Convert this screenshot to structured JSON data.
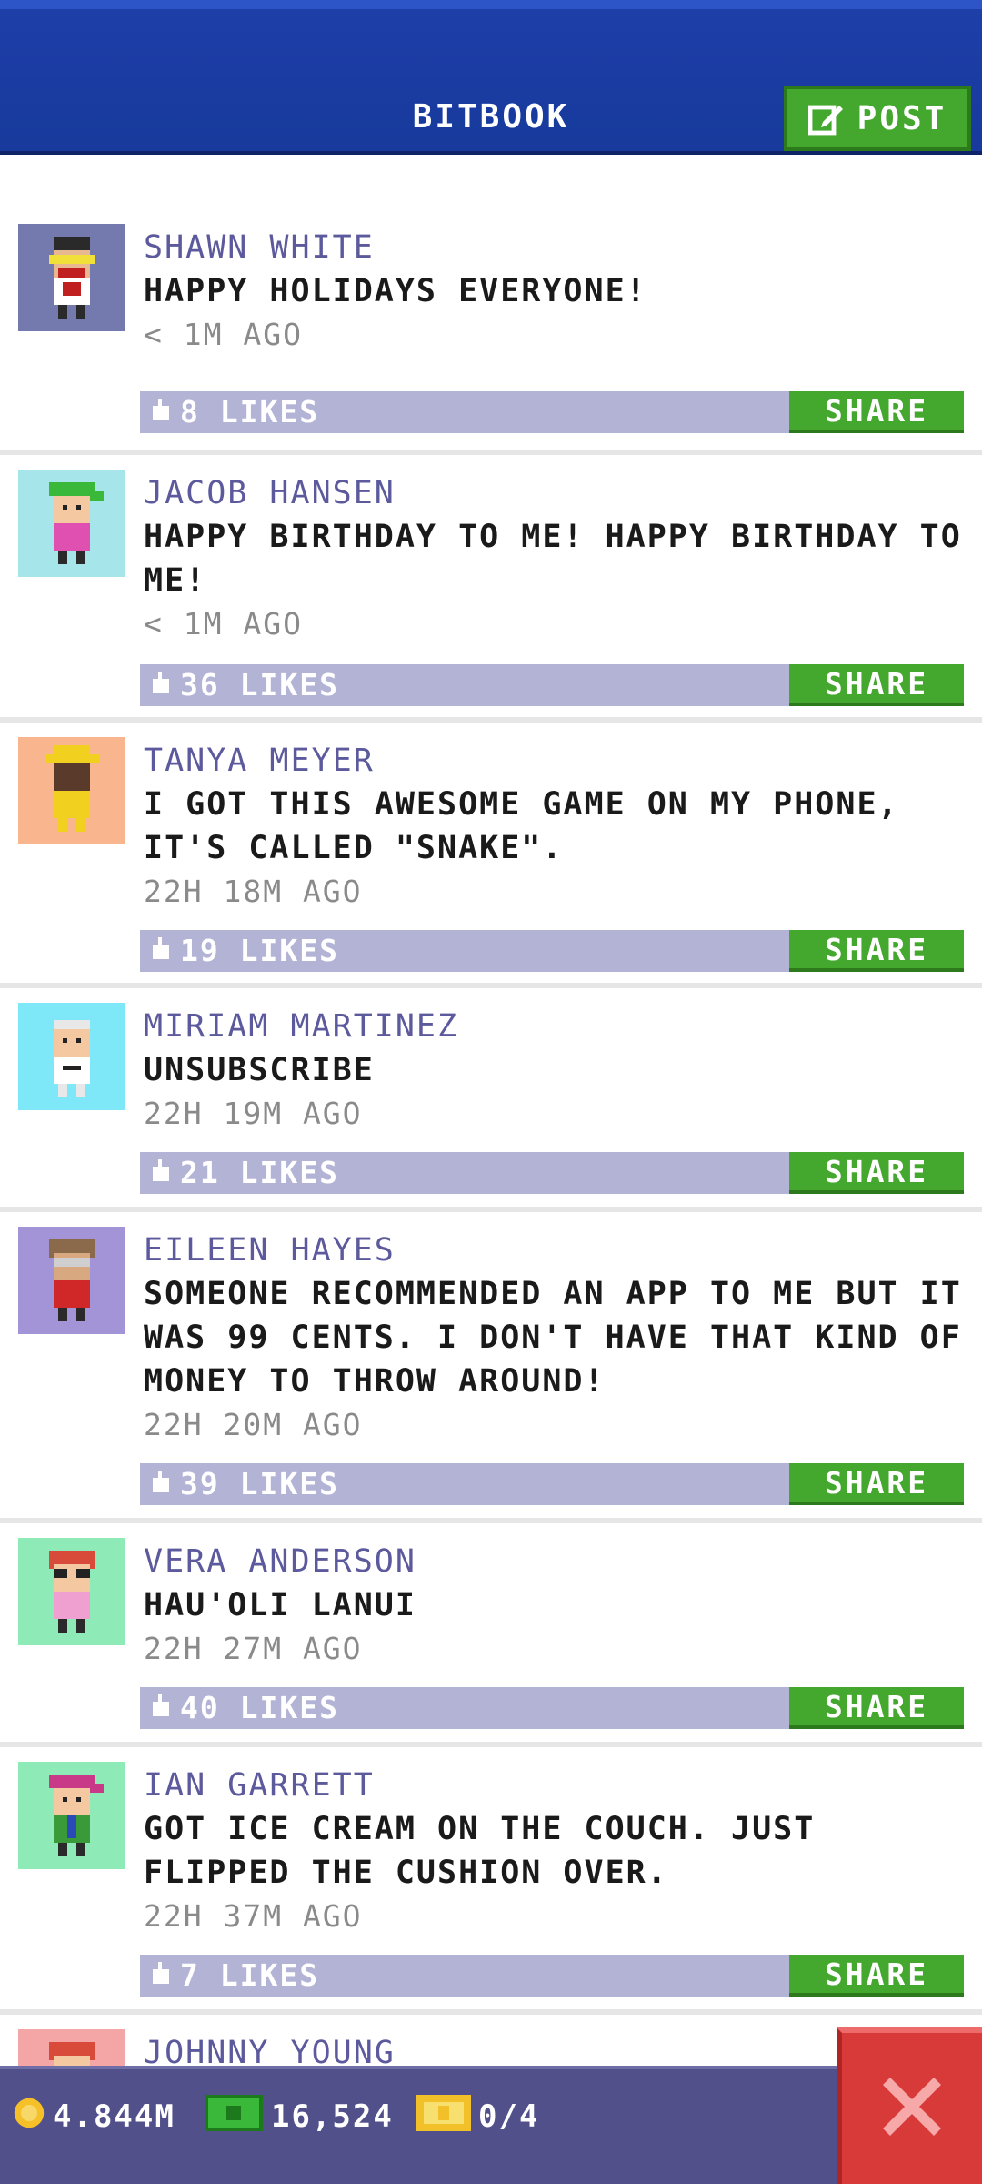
{
  "header": {
    "title": "BITBOOK",
    "post_label": "POST"
  },
  "colors": {
    "header": "#1e3ea8",
    "accent_green": "#45a82e",
    "likes_bar": "#b3b3d6",
    "name": "#5c5a9c",
    "close": "#d83a3a"
  },
  "share_label": "SHARE",
  "posts": [
    {
      "name": "SHAWN WHITE",
      "message": "HAPPY HOLIDAYS EVERYONE!",
      "time": "< 1M AGO",
      "likes": "8 LIKES",
      "avatar_bg": "#757aae"
    },
    {
      "name": "JACOB HANSEN",
      "message": "HAPPY BIRTHDAY TO ME! HAPPY BIRTHDAY TO ME!",
      "time": "< 1M AGO",
      "likes": "36 LIKES",
      "avatar_bg": "#a6e6ea"
    },
    {
      "name": "TANYA MEYER",
      "message": "I GOT THIS AWESOME GAME ON MY PHONE, IT'S CALLED \"SNAKE\".",
      "time": "22H 18M AGO",
      "likes": "19 LIKES",
      "avatar_bg": "#f8b58e"
    },
    {
      "name": "MIRIAM MARTINEZ",
      "message": "UNSUBSCRIBE",
      "time": "22H 19M AGO",
      "likes": "21 LIKES",
      "avatar_bg": "#7ee8f8"
    },
    {
      "name": "EILEEN HAYES",
      "message": "SOMEONE RECOMMENDED AN APP TO ME BUT IT WAS 99 CENTS. I DON'T HAVE THAT KIND OF MONEY TO THROW AROUND!",
      "time": "22H 20M AGO",
      "likes": "39 LIKES",
      "avatar_bg": "#a294d6"
    },
    {
      "name": "VERA ANDERSON",
      "message": "HAU'OLI LANUI",
      "time": "22H 27M AGO",
      "likes": "40 LIKES",
      "avatar_bg": "#8eeab6"
    },
    {
      "name": "IAN GARRETT",
      "message": "GOT ICE CREAM ON THE COUCH. JUST FLIPPED THE CUSHION OVER.",
      "time": "22H 37M AGO",
      "likes": "7 LIKES",
      "avatar_bg": "#8eeab6"
    },
    {
      "name": "JOHNNY YOUNG",
      "message": "",
      "time": "",
      "likes": "",
      "avatar_bg": "#f4a6a6"
    }
  ],
  "footer": {
    "coins": "4.844M",
    "bux": "16,524",
    "tickets": "0/4"
  }
}
